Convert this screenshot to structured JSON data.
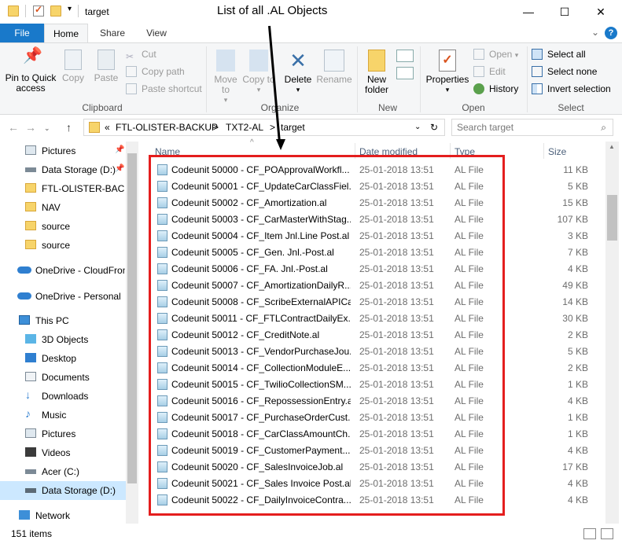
{
  "window": {
    "title": "target",
    "annotation": "List of all .AL Objects",
    "minimize_glyph": "—",
    "maximize_glyph": "☐",
    "close_glyph": "✕"
  },
  "ribbon_tabs": [
    "File",
    "Home",
    "Share",
    "View"
  ],
  "ribbon": {
    "clipboard": {
      "label": "Clipboard",
      "pin": "Pin to Quick access",
      "copy": "Copy",
      "paste": "Paste",
      "cut": "Cut",
      "copy_path": "Copy path",
      "paste_shortcut": "Paste shortcut"
    },
    "organize": {
      "label": "Organize",
      "move_to": "Move to",
      "copy_to": "Copy to",
      "delete": "Delete",
      "rename": "Rename"
    },
    "new": {
      "label": "New",
      "new_folder": "New folder"
    },
    "open": {
      "label": "Open",
      "properties": "Properties",
      "open": "Open",
      "edit": "Edit",
      "history": "History"
    },
    "select": {
      "label": "Select",
      "select_all": "Select all",
      "select_none": "Select none",
      "invert_selection": "Invert selection"
    }
  },
  "address": {
    "prefix": "«",
    "crumbs": [
      "FTL-OLISTER-BACKUP",
      "TXT2-AL",
      "target"
    ],
    "separator": ">",
    "search_placeholder": "Search target"
  },
  "nav": {
    "items": [
      {
        "label": "Pictures",
        "icon": "pictures-icon"
      },
      {
        "label": "Data Storage (D:)",
        "icon": "drive-icon"
      },
      {
        "label": "FTL-OLISTER-BACKUP",
        "icon": "folder-icon"
      },
      {
        "label": "NAV",
        "icon": "folder-icon"
      },
      {
        "label": "source",
        "icon": "folder-icon"
      },
      {
        "label": "source",
        "icon": "folder-icon"
      },
      {
        "label": "OneDrive - CloudFronts",
        "icon": "onedrive-icon"
      },
      {
        "label": "OneDrive - Personal",
        "icon": "onedrive-icon"
      },
      {
        "label": "This PC",
        "icon": "pc-icon"
      },
      {
        "label": "3D Objects",
        "icon": "3d-objects-icon"
      },
      {
        "label": "Desktop",
        "icon": "desktop-icon"
      },
      {
        "label": "Documents",
        "icon": "documents-icon"
      },
      {
        "label": "Downloads",
        "icon": "downloads-icon"
      },
      {
        "label": "Music",
        "icon": "music-icon"
      },
      {
        "label": "Pictures",
        "icon": "pictures-icon"
      },
      {
        "label": "Videos",
        "icon": "videos-icon"
      },
      {
        "label": "Acer (C:)",
        "icon": "drive-icon"
      },
      {
        "label": "Data Storage (D:)",
        "icon": "drive-icon"
      },
      {
        "label": "Network",
        "icon": "network-icon"
      }
    ]
  },
  "list": {
    "columns": [
      "Name",
      "Date modified",
      "Type",
      "Size"
    ],
    "rows": [
      {
        "name": "Codeunit 50000 - CF_POApprovalWorkfl...",
        "date": "25-01-2018 13:51",
        "type": "AL File",
        "size": "11 KB"
      },
      {
        "name": "Codeunit 50001 - CF_UpdateCarClassFiel...",
        "date": "25-01-2018 13:51",
        "type": "AL File",
        "size": "5 KB"
      },
      {
        "name": "Codeunit 50002 - CF_Amortization.al",
        "date": "25-01-2018 13:51",
        "type": "AL File",
        "size": "15 KB"
      },
      {
        "name": "Codeunit 50003 - CF_CarMasterWithStag...",
        "date": "25-01-2018 13:51",
        "type": "AL File",
        "size": "107 KB"
      },
      {
        "name": "Codeunit 50004 - CF_Item Jnl.Line Post.al",
        "date": "25-01-2018 13:51",
        "type": "AL File",
        "size": "3 KB"
      },
      {
        "name": "Codeunit 50005 - CF_Gen. Jnl.-Post.al",
        "date": "25-01-2018 13:51",
        "type": "AL File",
        "size": "7 KB"
      },
      {
        "name": "Codeunit 50006 - CF_FA. Jnl.-Post.al",
        "date": "25-01-2018 13:51",
        "type": "AL File",
        "size": "4 KB"
      },
      {
        "name": "Codeunit 50007 - CF_AmortizationDailyR...",
        "date": "25-01-2018 13:51",
        "type": "AL File",
        "size": "49 KB"
      },
      {
        "name": "Codeunit 50008 - CF_ScribeExternalAPICa...",
        "date": "25-01-2018 13:51",
        "type": "AL File",
        "size": "14 KB"
      },
      {
        "name": "Codeunit 50011 - CF_FTLContractDailyEx...",
        "date": "25-01-2018 13:51",
        "type": "AL File",
        "size": "30 KB"
      },
      {
        "name": "Codeunit 50012 - CF_CreditNote.al",
        "date": "25-01-2018 13:51",
        "type": "AL File",
        "size": "2 KB"
      },
      {
        "name": "Codeunit 50013 - CF_VendorPurchaseJou...",
        "date": "25-01-2018 13:51",
        "type": "AL File",
        "size": "5 KB"
      },
      {
        "name": "Codeunit 50014 - CF_CollectionModuleE...",
        "date": "25-01-2018 13:51",
        "type": "AL File",
        "size": "2 KB"
      },
      {
        "name": "Codeunit 50015 - CF_TwilioCollectionSM...",
        "date": "25-01-2018 13:51",
        "type": "AL File",
        "size": "1 KB"
      },
      {
        "name": "Codeunit 50016 - CF_RepossessionEntry.al",
        "date": "25-01-2018 13:51",
        "type": "AL File",
        "size": "4 KB"
      },
      {
        "name": "Codeunit 50017 - CF_PurchaseOrderCust...",
        "date": "25-01-2018 13:51",
        "type": "AL File",
        "size": "1 KB"
      },
      {
        "name": "Codeunit 50018 - CF_CarClassAmountCh...",
        "date": "25-01-2018 13:51",
        "type": "AL File",
        "size": "1 KB"
      },
      {
        "name": "Codeunit 50019 - CF_CustomerPayment...",
        "date": "25-01-2018 13:51",
        "type": "AL File",
        "size": "4 KB"
      },
      {
        "name": "Codeunit 50020 - CF_SalesInvoiceJob.al",
        "date": "25-01-2018 13:51",
        "type": "AL File",
        "size": "17 KB"
      },
      {
        "name": "Codeunit 50021 - CF_Sales Invoice Post.al",
        "date": "25-01-2018 13:51",
        "type": "AL File",
        "size": "4 KB"
      },
      {
        "name": "Codeunit 50022 - CF_DailyInvoiceContra...",
        "date": "25-01-2018 13:51",
        "type": "AL File",
        "size": "4 KB"
      }
    ]
  },
  "status": {
    "count": "151 items"
  },
  "colors": {
    "accent": "#1979ca",
    "highlight_box": "#e41e1e",
    "selected_nav": "#cce8ff"
  }
}
